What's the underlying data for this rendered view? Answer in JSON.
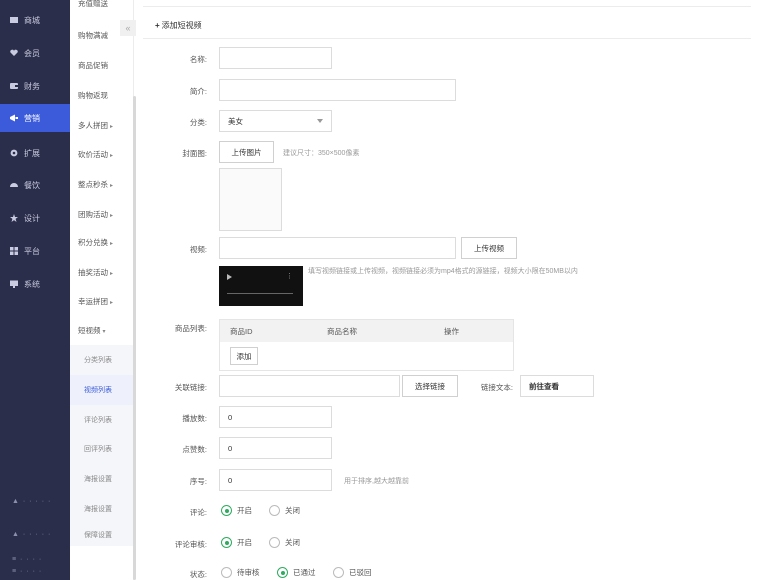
{
  "nav": {
    "items": [
      {
        "label": "商城",
        "icon": "shop-icon"
      },
      {
        "label": "会员",
        "icon": "heart-icon"
      },
      {
        "label": "财务",
        "icon": "wallet-icon"
      },
      {
        "label": "营销",
        "icon": "megaphone-icon"
      },
      {
        "label": "扩展",
        "icon": "gear-icon"
      },
      {
        "label": "餐饮",
        "icon": "dish-icon"
      },
      {
        "label": "设计",
        "icon": "star-icon"
      },
      {
        "label": "平台",
        "icon": "grid-icon"
      },
      {
        "label": "系统",
        "icon": "monitor-icon"
      }
    ],
    "active_index": 3
  },
  "submenu": {
    "collapse_label": "«",
    "items": [
      "充值赠送",
      "购物满减",
      "商品促销",
      "购物返现",
      "多人拼团",
      "砍价活动",
      "整点秒杀",
      "团购活动",
      "积分兑换",
      "抽奖活动",
      "幸运拼团",
      "短视频"
    ],
    "items_with_arrow": [
      4,
      5,
      6,
      7,
      8,
      9,
      10
    ],
    "expanded_arrow": "▾",
    "collapsed_arrow": "▸",
    "children": [
      "分类列表",
      "视频列表",
      "评论列表",
      "回评列表",
      "海报设置",
      "海报设置",
      "保障设置"
    ],
    "active_child": 1
  },
  "page": {
    "title_icon": "+",
    "title": "添加短视频"
  },
  "form": {
    "name": {
      "label": "名称:",
      "value": ""
    },
    "intro": {
      "label": "简介:",
      "value": ""
    },
    "category": {
      "label": "分类:",
      "value": "美女"
    },
    "cover": {
      "label": "封面图:",
      "button": "上传图片",
      "hint": "建议尺寸：350×500像素"
    },
    "video": {
      "label": "视频:",
      "value": "",
      "button": "上传视频",
      "hint": "填写视频链接或上传视频，视频链接必须为mp4格式的源链接，视频大小限在50MB以内"
    },
    "goods": {
      "label": "商品列表:",
      "columns": [
        "商品ID",
        "商品名称",
        "操作"
      ],
      "add_button": "添加"
    },
    "link": {
      "label": "关联链接:",
      "value": "",
      "button": "选择链接",
      "text_label": "链接文本:",
      "text_value": "前往查看"
    },
    "plays": {
      "label": "播放数:",
      "value": "0"
    },
    "likes": {
      "label": "点赞数:",
      "value": "0"
    },
    "order": {
      "label": "序号:",
      "value": "0",
      "hint": "用于排序,越大越靠前"
    },
    "comment": {
      "label": "评论:",
      "options": [
        "开启",
        "关闭"
      ],
      "selected": 0
    },
    "review": {
      "label": "评论审核:",
      "options": [
        "开启",
        "关闭"
      ],
      "selected": 0
    },
    "status": {
      "label": "状态:",
      "options": [
        "待审核",
        "已通过",
        "已驳回"
      ],
      "selected": 1
    }
  },
  "colors": {
    "nav_bg": "#2b2e4a",
    "accent": "#3b5bdb",
    "radio_on": "#2eab5f"
  }
}
